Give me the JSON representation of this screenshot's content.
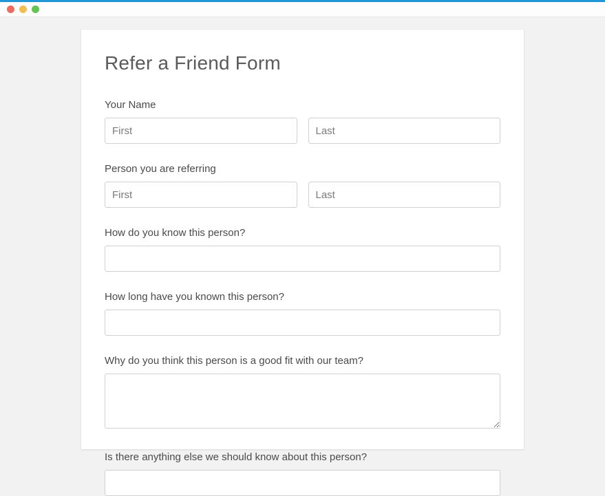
{
  "form": {
    "title": "Refer a Friend Form",
    "your_name": {
      "label": "Your Name",
      "first_placeholder": "First",
      "last_placeholder": "Last",
      "first_value": "",
      "last_value": ""
    },
    "referring": {
      "label": "Person you are referring",
      "first_placeholder": "First",
      "last_placeholder": "Last",
      "first_value": "",
      "last_value": ""
    },
    "how_know": {
      "label": "How do you know this person?",
      "value": ""
    },
    "how_long": {
      "label": "How long have you known this person?",
      "value": ""
    },
    "why_good_fit": {
      "label": "Why do you think this person is a good fit with our team?",
      "value": ""
    },
    "anything_else": {
      "label": "Is there anything else we should know about this person?",
      "value": ""
    }
  }
}
